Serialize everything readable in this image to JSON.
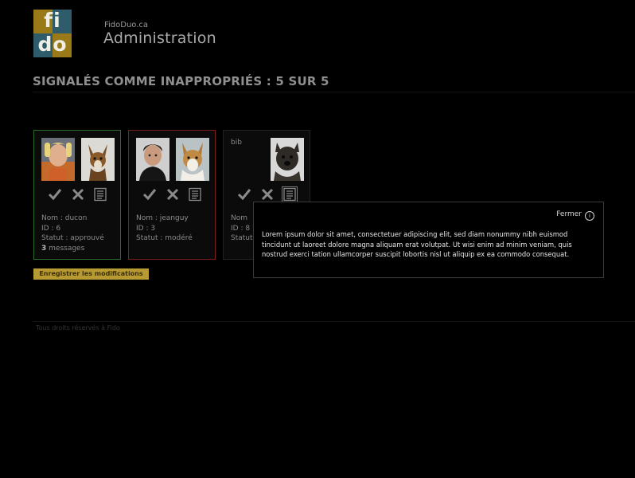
{
  "header": {
    "logo_text_top": "fi",
    "logo_text_bottom": "do",
    "site_name": "FidoDuo.ca",
    "site_title": "Administration"
  },
  "page": {
    "title": "SIGNALÉS COMME INAPPROPRIÉS : 5 SUR 5"
  },
  "cards": [
    {
      "username": "",
      "status_color": "#2d6b2d",
      "name_label": "Nom : ducon",
      "id_label": "ID : 6",
      "status_label": "Statut : approuvé",
      "messages_count": "3",
      "messages_label": "messages"
    },
    {
      "username": "",
      "status_color": "#7a1c1c",
      "name_label": "Nom : jeanguy",
      "id_label": "ID : 3",
      "status_label": "Statut : modéré"
    },
    {
      "username": "bib",
      "name_label": "Nom",
      "id_label": "ID : 8",
      "status_label": "Statut"
    }
  ],
  "actions": {
    "approve_icon": "checkmark-icon",
    "reject_icon": "x-icon",
    "details_icon": "document-icon"
  },
  "save_button": "Enregistrer les modifications",
  "footer": "Tous droits réservés à Fido",
  "popup": {
    "close_label": "Fermer",
    "close_icon_glyph": "i",
    "text": "Lorem ipsum dolor sit amet, consectetuer adipiscing elit, sed diam nonummy nibh euismod tincidunt ut laoreet dolore magna aliquam erat volutpat. Ut wisi enim ad minim veniam, quis nostrud exerci tation ullamcorper suscipit lobortis nisl ut aliquip ex ea commodo consequat."
  },
  "colors": {
    "accent_gold": "#b89a32",
    "logo_gold": "#9a7a18",
    "logo_teal": "#2f5c6a"
  }
}
